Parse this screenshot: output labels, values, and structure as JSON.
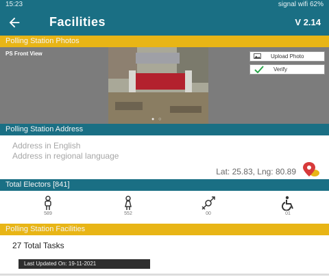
{
  "status_bar": {
    "time": "15:23",
    "right_icons": "signal wifi 62%"
  },
  "app_bar": {
    "title": "Facilities",
    "version": "V 2.14"
  },
  "photos_section": {
    "header": "Polling Station Photos",
    "photo_label": "PS Front View",
    "upload_label": "Upload Photo",
    "verify_label": "Verify"
  },
  "address_section": {
    "header": "Polling Station Address",
    "english_placeholder": "Address in English",
    "regional_placeholder": "Address in regional language",
    "latlng": "Lat: 25.83, Lng: 80.89"
  },
  "electors_section": {
    "header": "Total Electors [841]",
    "items": [
      {
        "icon": "male-icon",
        "count": "589"
      },
      {
        "icon": "female-icon",
        "count": "552"
      },
      {
        "icon": "third-gender-icon",
        "count": "00"
      },
      {
        "icon": "wheelchair-icon",
        "count": "01"
      }
    ]
  },
  "facilities_section": {
    "header": "Polling Station Facilities",
    "tasks": "27 Total Tasks",
    "last_updated": "Last Updated On: 19-11-2021"
  },
  "colors": {
    "primary": "#1a6f84",
    "accent": "#e8b516"
  }
}
